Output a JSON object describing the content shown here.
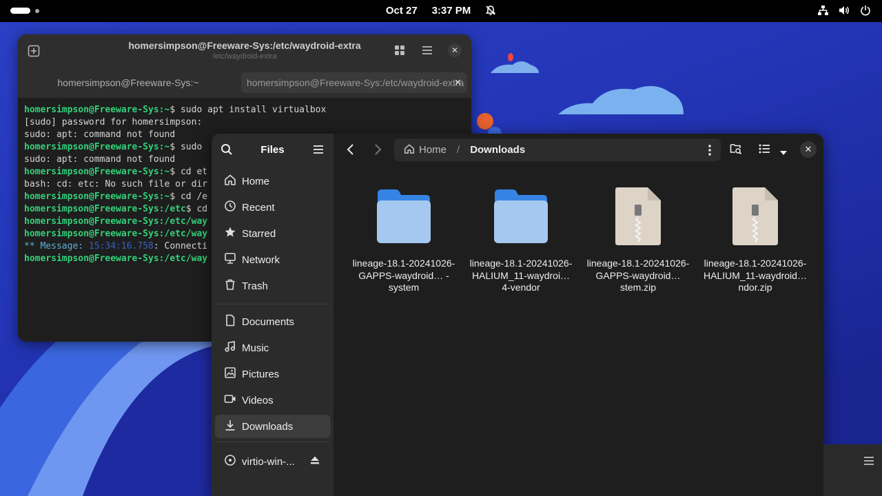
{
  "topbar": {
    "date": "Oct 27",
    "time": "3:37 PM",
    "icons": [
      "activities-indicator",
      "notifications-off-icon",
      "network-icon",
      "volume-icon",
      "power-icon"
    ]
  },
  "terminal": {
    "title": "homersimpson@Freeware-Sys:/etc/waydroid-extra",
    "subtitle": "/etc/waydroid-extra",
    "tabs": [
      {
        "label": "homersimpson@Freeware-Sys:~"
      },
      {
        "label": "homersimpson@Freeware-Sys:/etc/waydroid-extra"
      }
    ],
    "lines": [
      {
        "prompt": "homersimpson@Freeware-Sys:",
        "path": "~",
        "text": "$ sudo apt install virtualbox"
      },
      {
        "text": "[sudo] password for homersimpson:"
      },
      {
        "text": "sudo: apt: command not found"
      },
      {
        "prompt": "homersimpson@Freeware-Sys:",
        "path": "~",
        "text": "$ sudo"
      },
      {
        "text": "sudo: apt: command not found"
      },
      {
        "prompt": "homersimpson@Freeware-Sys:",
        "path": "~",
        "text": "$ cd et"
      },
      {
        "text": "bash: cd: etc: No such file or dir"
      },
      {
        "prompt": "homersimpson@Freeware-Sys:",
        "path": "~",
        "text": "$ cd /e"
      },
      {
        "prompt": "homersimpson@Freeware-Sys:",
        "path": "/etc",
        "text": "$ cd"
      },
      {
        "prompt": "homersimpson@Freeware-Sys:",
        "path": "/etc/way",
        "text": ""
      },
      {
        "prompt": "homersimpson@Freeware-Sys:",
        "path": "/etc/way",
        "text": ""
      },
      {
        "message": "** Message: ",
        "time": "15:34:16.758",
        "text": ": Connecti"
      },
      {
        "prompt": "homersimpson@Freeware-Sys:",
        "path": "/etc/way",
        "text": ""
      }
    ]
  },
  "files": {
    "sidebar_title": "Files",
    "places": [
      {
        "label": "Home",
        "icon": "home-icon"
      },
      {
        "label": "Recent",
        "icon": "clock-icon"
      },
      {
        "label": "Starred",
        "icon": "star-icon"
      },
      {
        "label": "Network",
        "icon": "network-icon"
      },
      {
        "label": "Trash",
        "icon": "trash-icon"
      }
    ],
    "bookmarks": [
      {
        "label": "Documents",
        "icon": "document-icon"
      },
      {
        "label": "Music",
        "icon": "music-icon"
      },
      {
        "label": "Pictures",
        "icon": "picture-icon"
      },
      {
        "label": "Videos",
        "icon": "video-icon"
      },
      {
        "label": "Downloads",
        "icon": "download-icon",
        "active": true
      }
    ],
    "devices": [
      {
        "label": "virtio-win-...",
        "icon": "disc-icon"
      }
    ],
    "path": {
      "home": "Home",
      "separator": "/",
      "current": "Downloads"
    },
    "items": [
      {
        "type": "folder",
        "name": "lineage-18.1-20241026-GAPPS-waydroid… -system"
      },
      {
        "type": "folder",
        "name": "lineage-18.1-20241026-HALIUM_11-waydroi… 4-vendor"
      },
      {
        "type": "zip",
        "name": "lineage-18.1-20241026-GAPPS-waydroid…stem.zip"
      },
      {
        "type": "zip",
        "name": "lineage-18.1-20241026-HALIUM_11-waydroid… ndor.zip"
      }
    ]
  },
  "colors": {
    "prompt_green": "#33d17a",
    "folder_blue": "#62a0ea",
    "folder_light": "#a5c8f0",
    "wallpaper_blue": "#2436b8"
  }
}
